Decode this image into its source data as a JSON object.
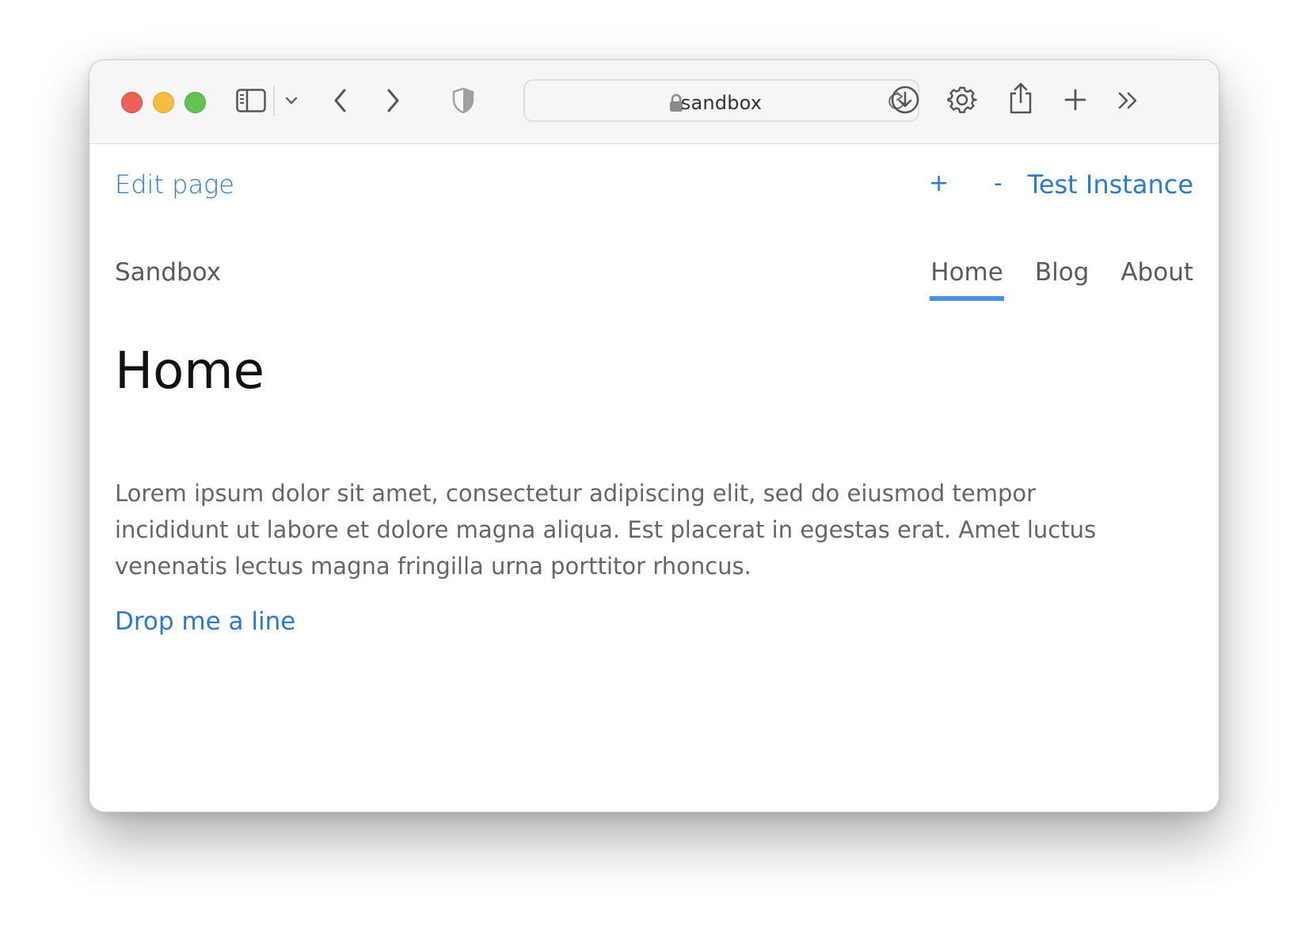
{
  "browser": {
    "url": "sandbox",
    "traffic_lights": {
      "close": "#ee5f57",
      "minimize": "#f4bd3f",
      "zoom": "#5fc454"
    },
    "toolbar_icons": [
      "sidebar-icon",
      "chevron-down-icon",
      "back-icon",
      "forward-icon",
      "shield-icon",
      "lock-icon",
      "reload-icon",
      "download-icon",
      "gear-icon",
      "share-icon",
      "new-tab-icon",
      "more-icon"
    ]
  },
  "topbar": {
    "edit_label": "Edit page",
    "plus_label": "+",
    "minus_label": "-",
    "instance_label": "Test Instance"
  },
  "header": {
    "site_title": "Sandbox",
    "nav": [
      {
        "label": "Home",
        "active": true
      },
      {
        "label": "Blog",
        "active": false
      },
      {
        "label": "About",
        "active": false
      }
    ]
  },
  "main": {
    "heading": "Home",
    "paragraph": "Lorem ipsum dolor sit amet, consectetur adipiscing elit, sed do eiusmod tempor incididunt ut labore et dolore magna aliqua. Est placerat in egestas erat. Amet luctus venenatis lectus magna fringilla urna porttitor rhoncus.",
    "cta_label": "Drop me a line"
  },
  "colors": {
    "link": "#2a7ad2",
    "nav_underline": "#4a8fe6",
    "text_muted": "#666666",
    "heading": "#111111"
  }
}
